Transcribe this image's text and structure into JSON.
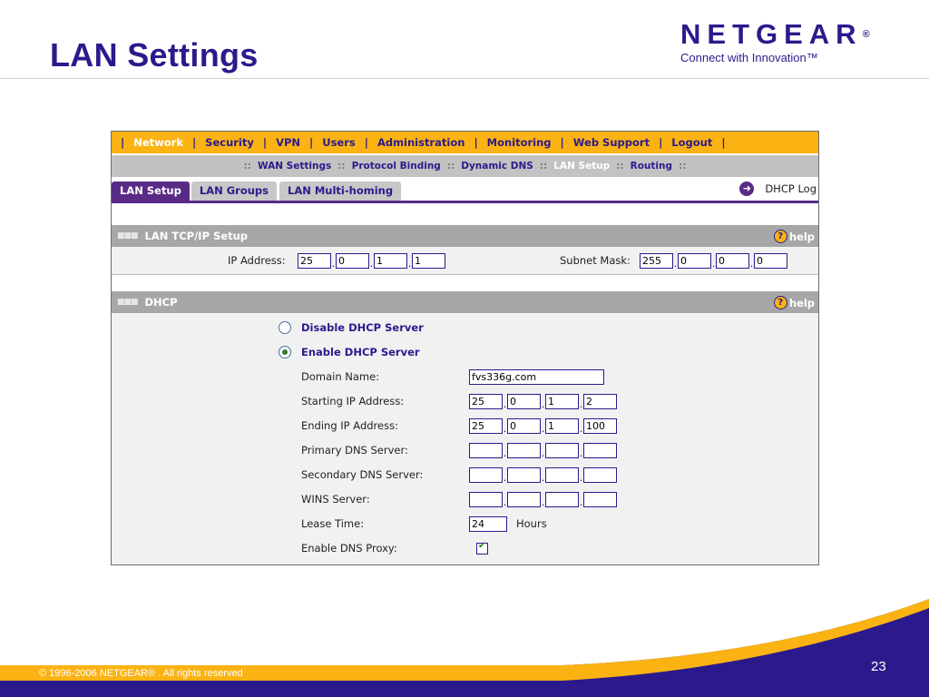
{
  "slide": {
    "title": "LAN Settings",
    "logo_word": "NETGEAR",
    "logo_reg": "®",
    "logo_tagline": "Connect with Innovation™",
    "copyright": "© 1996-2006 NETGEAR® . All rights reserved",
    "page_number": "23"
  },
  "topnav": [
    "Network",
    "Security",
    "VPN",
    "Users",
    "Administration",
    "Monitoring",
    "Web Support",
    "Logout"
  ],
  "topnav_active": "Network",
  "subnav": [
    "WAN Settings",
    "Protocol Binding",
    "Dynamic DNS",
    "LAN Setup",
    "Routing"
  ],
  "subnav_active": "LAN Setup",
  "tabs": [
    "LAN Setup",
    "LAN Groups",
    "LAN Multi-homing"
  ],
  "tabs_active": "LAN Setup",
  "dhcp_log": "DHCP Log",
  "help_label": "help",
  "lan_tcpip": {
    "title": "LAN TCP/IP Setup",
    "ip_label": "IP Address:",
    "ip": [
      "25",
      "0",
      "1",
      "1"
    ],
    "mask_label": "Subnet Mask:",
    "mask": [
      "255",
      "0",
      "0",
      "0"
    ]
  },
  "dhcp": {
    "title": "DHCP",
    "disable_label": "Disable DHCP Server",
    "enable_label": "Enable DHCP Server",
    "enabled": true,
    "domain_label": "Domain Name:",
    "domain_value": "fvs336g.com",
    "start_label": "Starting IP Address:",
    "start_ip": [
      "25",
      "0",
      "1",
      "2"
    ],
    "end_label": "Ending IP Address:",
    "end_ip": [
      "25",
      "0",
      "1",
      "100"
    ],
    "pdns_label": "Primary DNS Server:",
    "pdns": [
      "",
      "",
      "",
      ""
    ],
    "sdns_label": "Secondary DNS Server:",
    "sdns": [
      "",
      "",
      "",
      ""
    ],
    "wins_label": "WINS Server:",
    "wins": [
      "",
      "",
      "",
      ""
    ],
    "lease_label": "Lease Time:",
    "lease_value": "24",
    "lease_unit": "Hours",
    "proxy_label": "Enable DNS Proxy:",
    "proxy_checked": true
  }
}
